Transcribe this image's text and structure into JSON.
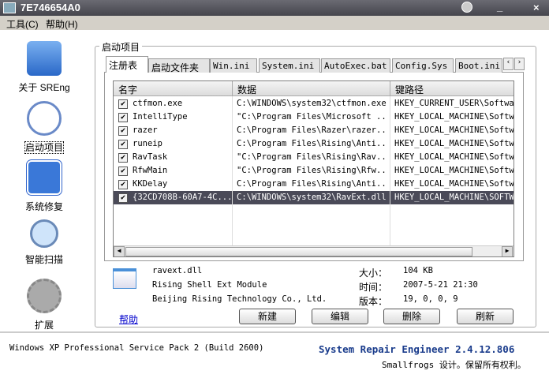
{
  "window": {
    "title": "7E746654A0"
  },
  "menu": [
    "工具(C)",
    "帮助(H)"
  ],
  "sidebar": [
    {
      "label": "关于 SREng",
      "icon": "tools-icon"
    },
    {
      "label": "启动项目",
      "icon": "clock-icon"
    },
    {
      "label": "系统修复",
      "icon": "checklist-icon"
    },
    {
      "label": "智能扫描",
      "icon": "magnifier-icon"
    },
    {
      "label": "扩展",
      "icon": "gear-plus-icon"
    }
  ],
  "group_title": "启动项目",
  "tabs": [
    "注册表",
    "启动文件夹",
    "Win.ini",
    "System.ini",
    "AutoExec.bat",
    "Config.Sys",
    "Boot.ini"
  ],
  "columns": [
    "名字",
    "数据",
    "键路径"
  ],
  "rows": [
    {
      "name": "ctfmon.exe",
      "data": "C:\\WINDOWS\\system32\\ctfmon.exe",
      "path": "HKEY_CURRENT_USER\\Softwar",
      "checked": true
    },
    {
      "name": "IntelliType",
      "data": "\"C:\\Program Files\\Microsoft ...",
      "path": "HKEY_LOCAL_MACHINE\\Softwa",
      "checked": true
    },
    {
      "name": "razer",
      "data": "C:\\Program Files\\Razer\\razer...",
      "path": "HKEY_LOCAL_MACHINE\\Softwa",
      "checked": true
    },
    {
      "name": "runeip",
      "data": "C:\\Program Files\\Rising\\Anti...",
      "path": "HKEY_LOCAL_MACHINE\\Softwa",
      "checked": true
    },
    {
      "name": "RavTask",
      "data": "\"C:\\Program Files\\Rising\\Rav...",
      "path": "HKEY_LOCAL_MACHINE\\Softwa",
      "checked": true
    },
    {
      "name": "RfwMain",
      "data": "\"C:\\Program Files\\Rising\\Rfw...",
      "path": "HKEY_LOCAL_MACHINE\\Softwa",
      "checked": true
    },
    {
      "name": "KKDelay",
      "data": "C:\\Program Files\\Rising\\Anti...",
      "path": "HKEY_LOCAL_MACHINE\\Softwa",
      "checked": true
    },
    {
      "name": "{32CD708B-60A7-4C...",
      "data": "C:\\WINDOWS\\system32\\RavExt.dll",
      "path": "HKEY_LOCAL_MACHINE\\SOFTWA",
      "checked": true,
      "selected": true
    }
  ],
  "info": {
    "file": "ravext.dll",
    "desc": "Rising Shell Ext Module",
    "company": "Beijing Rising Technology Co., Ltd.",
    "size_label": "大小：",
    "size": "104 KB",
    "time_label": "时间：",
    "time": "2007-5-21 21:30",
    "ver_label": "版本：",
    "version": "19, 0, 0, 9"
  },
  "help_link": "帮助",
  "buttons": [
    "新建",
    "编辑",
    "删除",
    "刷新"
  ],
  "footer": {
    "os": "Windows XP Professional Service Pack 2 (Build 2600)",
    "product": "System Repair Engineer 2.4.12.806",
    "credit": "Smallfrogs 设计。保留所有权利。"
  },
  "colors": {
    "selection": "#4a4a58",
    "product": "#1a3c8c",
    "link": "#0000cc"
  }
}
